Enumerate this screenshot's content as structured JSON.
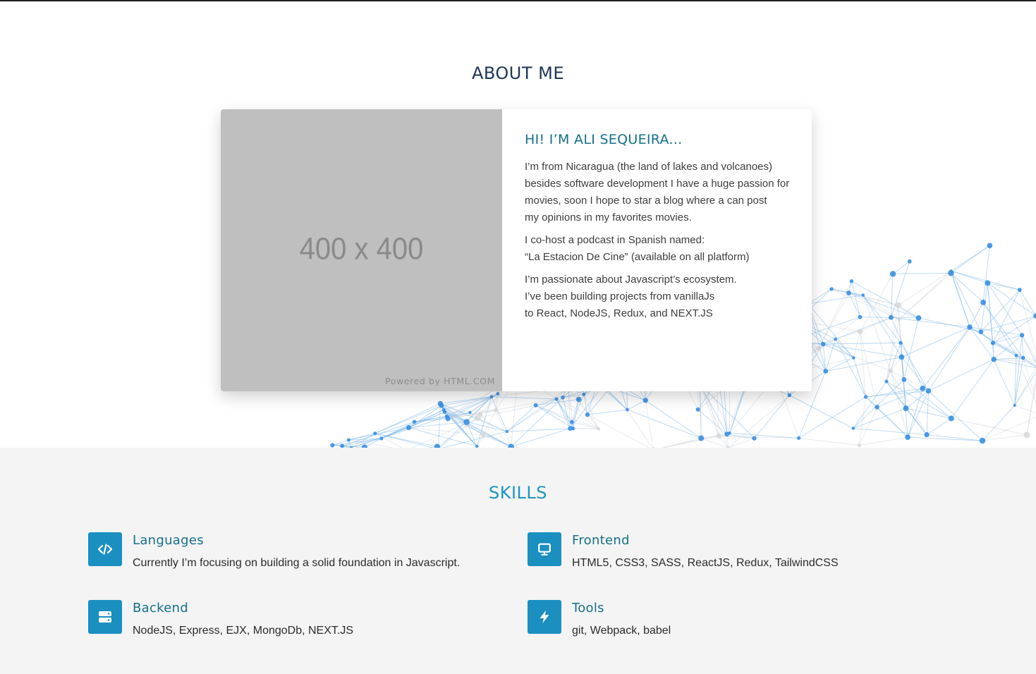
{
  "about": {
    "title": "ABOUT ME",
    "placeholder_text": "400 x 400",
    "placeholder_credit": "Powered by HTML.COM",
    "greeting": "HI! I’M ALI SEQUEIRA...",
    "paragraphs": [
      "I’m from Nicaragua (the land of lakes and volcanoes)\nbesides software development I have a huge passion for\nmovies, soon I hope to star a blog where a can post\nmy opinions in my favorites movies.",
      "I co-host a podcast in Spanish named:\n“La Estacion De Cine” (available on all platform)",
      "I’m passionate about Javascript’s ecosystem.\nI’ve been building projects from vanillaJs\nto React, NodeJS, Redux, and NEXT.JS"
    ]
  },
  "skills": {
    "title": "SKILLS",
    "items": [
      {
        "icon": "code-icon",
        "name": "Languages",
        "desc": "Currently I’m focusing on building a solid foundation in Javascript."
      },
      {
        "icon": "monitor-icon",
        "name": "Frontend",
        "desc": "HTML5, CSS3, SASS, ReactJS, Redux, TailwindCSS"
      },
      {
        "icon": "server-icon",
        "name": "Backend",
        "desc": "NodeJS, Express, EJX, MongoDb, NEXT.JS"
      },
      {
        "icon": "bolt-icon",
        "name": "Tools",
        "desc": "git, Webpack, babel"
      }
    ]
  },
  "colors": {
    "accent": "#1a8fc0",
    "heading_dark": "#1d3557",
    "heading_teal": "#15708a",
    "skills_bg": "#f4f4f4",
    "network_blue": "#3b8fe0"
  }
}
